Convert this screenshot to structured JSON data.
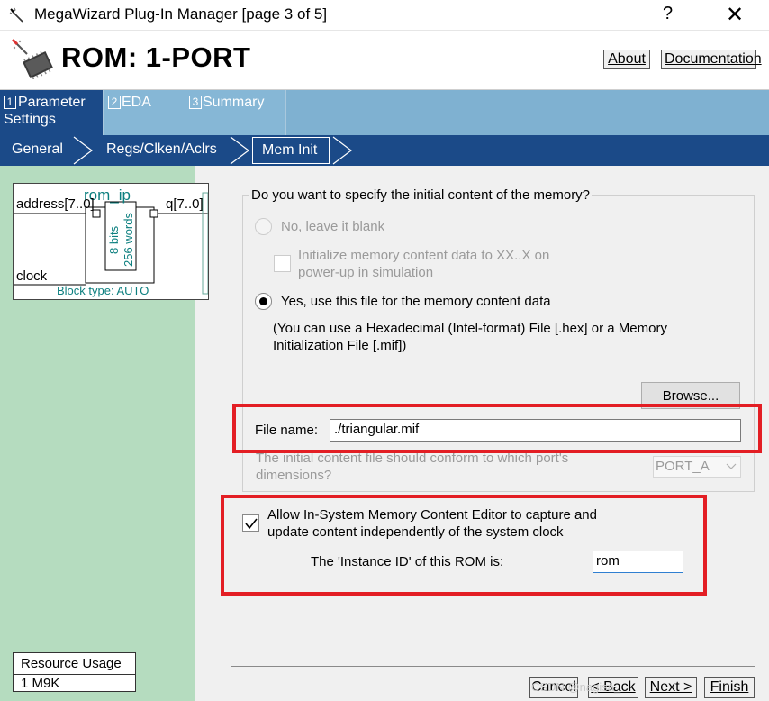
{
  "window": {
    "title": "MegaWizard Plug-In Manager [page 3 of 5]",
    "help_glyph": "?",
    "close_glyph": "✕"
  },
  "header": {
    "title": "ROM: 1-PORT",
    "about_label": "About",
    "documentation_label": "Documentation"
  },
  "tabs": [
    {
      "num": "1",
      "label": "Parameter Settings",
      "active": true
    },
    {
      "num": "2",
      "label": "EDA",
      "active": false
    },
    {
      "num": "3",
      "label": "Summary",
      "active": false
    }
  ],
  "subtabs": [
    {
      "label": "General"
    },
    {
      "label": "Regs/Clken/Aclrs"
    },
    {
      "label": "Mem Init",
      "active": true
    }
  ],
  "block_symbol": {
    "instance_name": "rom_ip",
    "address_port": "address[7..0]",
    "q_port": "q[7..0]",
    "clock_port": "clock",
    "bits_label": "8 bits",
    "words_label": "256 words",
    "block_type": "Block type: AUTO"
  },
  "resource_usage": {
    "title": "Resource Usage",
    "value": "1 M9K"
  },
  "mem_init": {
    "question": "Do you want to specify the initial content of the memory?",
    "option_blank": "No, leave it blank",
    "init_xx_line1": "Initialize memory content data to XX..X on",
    "init_xx_line2": "power-up in simulation",
    "option_file": "Yes, use this file for the memory content data",
    "file_hint_line1": "(You can use a Hexadecimal (Intel-format) File [.hex] or a Memory",
    "file_hint_line2": "Initialization File [.mif])",
    "browse_label": "Browse...",
    "file_name_label": "File name:",
    "file_name_value": "./triangular.mif",
    "conform_line1": "The initial content file should conform to which port's",
    "conform_line2": "dimensions?",
    "port_value": "PORT_A",
    "allow_editor_line1": "Allow In-System Memory Content Editor to capture and",
    "allow_editor_line2": "update content independently of the system clock",
    "allow_editor_checked": true,
    "instance_id_label": "The 'Instance ID' of this ROM is:",
    "instance_id_value": "rom"
  },
  "footer": {
    "cancel_label": "Cancel",
    "back_label": "< Back",
    "next_label": "Next >",
    "finish_label": "Finish",
    "watermark": "CSDN @nagisa_"
  },
  "colors": {
    "tab_active": "#1b4a88",
    "tab_inactive": "#86b7d6",
    "left_panel": "#b5dcbf",
    "highlight_red": "#e31e24"
  }
}
